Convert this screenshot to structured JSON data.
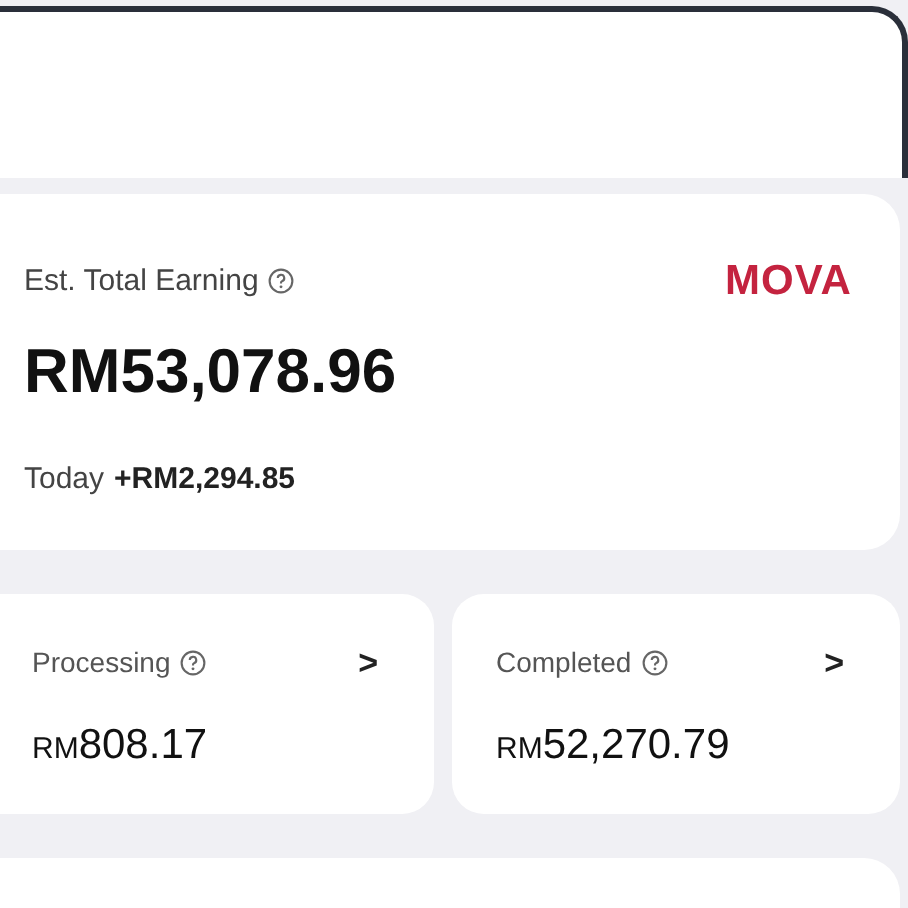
{
  "earnings": {
    "label": "Est. Total Earning",
    "brand": "MOVA",
    "amount": "RM53,078.96",
    "today_label": "Today",
    "today_value": "+RM2,294.85"
  },
  "stats": [
    {
      "label": "Processing",
      "currency": "RM",
      "amount": "808.17",
      "chevron": ">"
    },
    {
      "label": "Completed",
      "currency": "RM",
      "amount": "52,270.79",
      "chevron": ">"
    }
  ]
}
